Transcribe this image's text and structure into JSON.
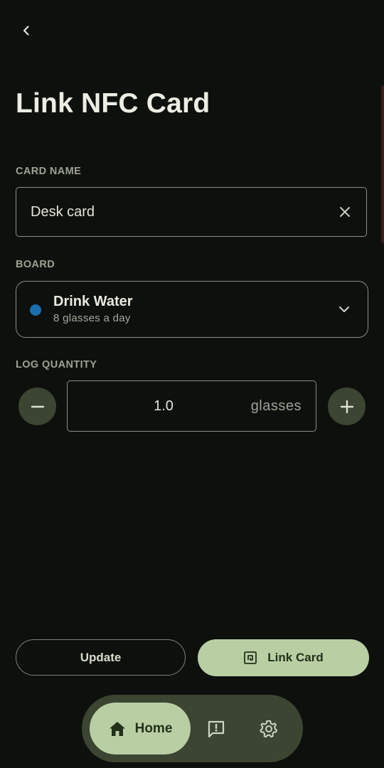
{
  "header": {
    "back_icon": "arrow-back-icon",
    "title": "Link NFC Card"
  },
  "card_name": {
    "label": "CARD NAME",
    "value": "Desk card",
    "clear_icon": "close-icon"
  },
  "board": {
    "label": "BOARD",
    "name": "Drink Water",
    "subtitle": "8 glasses a day",
    "dot_color": "#1a6fb0",
    "dropdown_icon": "chevron-down-icon"
  },
  "log_quantity": {
    "label": "LOG QUANTITY",
    "value": "1.0",
    "unit": "glasses",
    "decrement_icon": "minus-icon",
    "increment_icon": "plus-icon"
  },
  "actions": {
    "update_label": "Update",
    "link_label": "Link Card",
    "link_icon": "nfc-icon"
  },
  "nav": {
    "home_label": "Home",
    "home_icon": "home-icon",
    "feedback_icon": "feedback-icon",
    "settings_icon": "settings-gear-icon"
  },
  "colors": {
    "background": "#0d100c",
    "accent": "#b9cfa3",
    "accent_container": "#3b4532"
  }
}
